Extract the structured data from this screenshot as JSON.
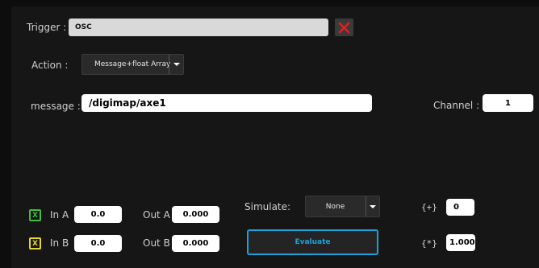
{
  "trigger": {
    "label": "Trigger :",
    "value": "OSC"
  },
  "action": {
    "label": "Action :",
    "selected": "Message+float Array"
  },
  "message": {
    "label": "message :",
    "value": "/digimap/axe1"
  },
  "channel": {
    "label": "Channel :",
    "value": "1"
  },
  "in_a": {
    "check": "X",
    "check_color": "#3fbf3f",
    "label": "In A",
    "value": "0.0"
  },
  "in_b": {
    "check": "X",
    "check_color": "#e6d62a",
    "label": "In B",
    "value": "0.0"
  },
  "out_a": {
    "label": "Out A",
    "value": "0.000"
  },
  "out_b": {
    "label": "Out B",
    "value": "0.000"
  },
  "simulate": {
    "label": "Simulate:",
    "selected": "None"
  },
  "plus": {
    "label": "{+}",
    "value": "0"
  },
  "mult": {
    "label": "{*}",
    "value": "1.000"
  },
  "evaluate": {
    "label": "Evaluate",
    "accent": "#1aa3d9"
  },
  "icons": {
    "delete": "close-icon",
    "dropdown": "chevron-down-icon"
  }
}
